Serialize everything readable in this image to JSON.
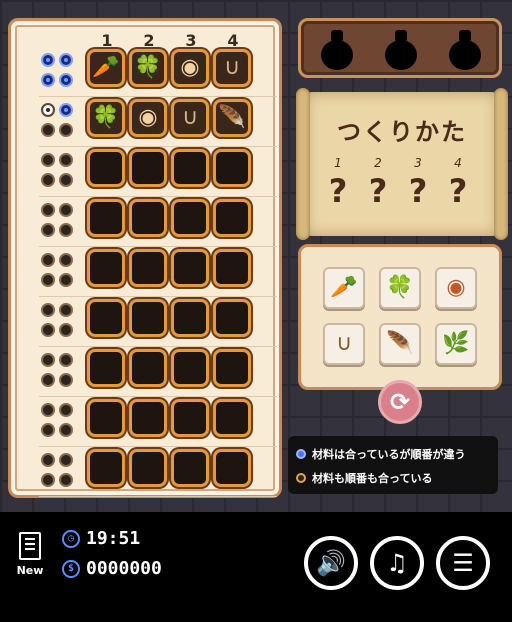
{
  "board": {
    "col_labels": [
      "1",
      "2",
      "3",
      "4"
    ],
    "rows": [
      {
        "pegs": [
          "blue",
          "blue",
          "blue",
          "blue"
        ],
        "slots": [
          "carrot",
          "clover",
          "eye",
          "horseshoe"
        ]
      },
      {
        "pegs": [
          "white",
          "blue",
          "dark",
          "dark"
        ],
        "slots": [
          "clover",
          "eye",
          "horseshoe",
          "feather"
        ]
      },
      {
        "pegs": [
          "dark",
          "dark",
          "dark",
          "dark"
        ],
        "slots": [
          "",
          "",
          "",
          ""
        ]
      },
      {
        "pegs": [
          "dark",
          "dark",
          "dark",
          "dark"
        ],
        "slots": [
          "",
          "",
          "",
          ""
        ]
      },
      {
        "pegs": [
          "dark",
          "dark",
          "dark",
          "dark"
        ],
        "slots": [
          "",
          "",
          "",
          ""
        ]
      },
      {
        "pegs": [
          "dark",
          "dark",
          "dark",
          "dark"
        ],
        "slots": [
          "",
          "",
          "",
          ""
        ]
      },
      {
        "pegs": [
          "dark",
          "dark",
          "dark",
          "dark"
        ],
        "slots": [
          "",
          "",
          "",
          ""
        ]
      },
      {
        "pegs": [
          "dark",
          "dark",
          "dark",
          "dark"
        ],
        "slots": [
          "",
          "",
          "",
          ""
        ]
      },
      {
        "pegs": [
          "dark",
          "dark",
          "dark",
          "dark"
        ],
        "slots": [
          "",
          "",
          "",
          ""
        ]
      }
    ]
  },
  "recipe": {
    "title": "つくりかた",
    "numbers": [
      "1",
      "2",
      "3",
      "4"
    ],
    "unknown": [
      "?",
      "?",
      "?",
      "?"
    ]
  },
  "ingredients": [
    "carrot",
    "clover",
    "eye",
    "horseshoe",
    "feather",
    "herb"
  ],
  "legend": {
    "partial": "材料は合っているが順番が違う",
    "exact": "材料も順番も合っている",
    "partial_color": "#4a73ff",
    "exact_color": "#e6a05a"
  },
  "footer": {
    "new_label": "New",
    "time": "19:51",
    "money": "0000000"
  },
  "icons": {
    "carrot": "🥕",
    "clover": "🍀",
    "eye": "◉",
    "horseshoe": "∪",
    "feather": "🪶",
    "herb": "🌿"
  }
}
